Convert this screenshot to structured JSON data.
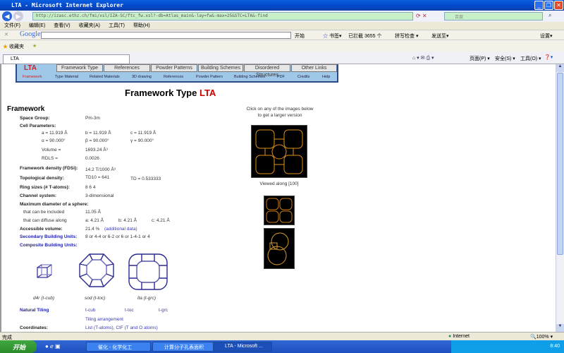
{
  "window": {
    "title": "LTA - Microsoft Internet Explorer"
  },
  "address": {
    "url": "http://izasc.ethz.ch/fmi/xsl/IZA-SC/ftc_fw.xsl?-db=Atlas_main&-lay=fw&-max=25&STC=LTA&-find",
    "search_placeholder": "百度"
  },
  "menu": [
    "文件(F)",
    "编辑(E)",
    "查看(V)",
    "收藏夹(A)",
    "工具(T)",
    "帮助(H)"
  ],
  "google_bar": {
    "logo": "Google",
    "start": "开始",
    "bookmarks": "书签▾",
    "blocked": "已拦截 3655 个",
    "spellcheck": "拼写检查 ▾",
    "send": "发送至▾",
    "settings": "设置▾"
  },
  "favorites": {
    "label": "收藏夹"
  },
  "tab": {
    "label": "LTA"
  },
  "ie_cmds": [
    "页面(P) ▾",
    "安全(S) ▾",
    "工具(O) ▾"
  ],
  "nav": {
    "code": "LTA",
    "tabs": [
      "Framework Type",
      "References",
      "Powder Patterns",
      "Building Schemes",
      "Disordered Structures",
      "Other Links"
    ],
    "sub": [
      "Framework",
      "Type Material",
      "Related Materials",
      "3D drawing",
      "References",
      "Powder Pattern",
      "Building Schemes",
      "PDF",
      "Credits",
      "Help"
    ]
  },
  "page": {
    "title_prefix": "Framework Type ",
    "title_code": "LTA",
    "section": "Framework",
    "space_group_label": "Space Group:",
    "space_group": "Pm-3m",
    "cell_label": "Cell Parameters:",
    "a": "a = 11.919 Å",
    "b": "b = 11.919 Å",
    "c": "c = 11.919 Å",
    "alpha": "α = 90.000°",
    "beta": "β = 90.000°",
    "gamma": "γ = 90.000°",
    "volume_label": "Volume =",
    "volume": "1693.24 Å³",
    "rdls_label": "RDLS =",
    "rdls": "0.0026",
    "fd_label": "Framework density (FDSi):",
    "fd": "14.2 T/1000 Å³",
    "td_label": "Topological density:",
    "td10": "TD10 = 641",
    "td": "TD = 0.533333",
    "rings_label": "Ring sizes (# T-atoms):",
    "rings": "8  6  4",
    "channel_label": "Channel system:",
    "channel": "3-dimensional",
    "maxdiam_label": "Maximum diameter of a sphere:",
    "included_label": "that can be included",
    "included": "11.05 Å",
    "diffuse_label": "that can diffuse along",
    "diff_a": "a:  4.21 Å",
    "diff_b": "b:  4.21 Å",
    "diff_c": "c:  4.21 Å",
    "accvol_label": "Accessible volume:",
    "accvol": "21.4  %",
    "accvol_link": "(additional data)",
    "sbu_label": "Secondary Building Units:",
    "sbu": "8 or 4-4 or 6-2 or 6 or 1-4-1 or 4",
    "cbu_label": "Composite Building Units:",
    "cbus": [
      "d4r (t-cub)",
      "sod (t-toc)",
      "lta (t-grc)"
    ],
    "tiling_label": "Natural Tiling",
    "tilings": [
      "t-cub",
      "t-toc",
      "t-grc"
    ],
    "tiling_arr": "Tiling arrangement",
    "coord_label": "Coordinates:",
    "coord": "List (T-atoms), CIF (T and O atoms)",
    "images_hint_1": "Click on any of the images below",
    "images_hint_2": "to get a larger version",
    "viewed": "Viewed along [100]"
  },
  "status": {
    "left": "完成",
    "zone": "Internet",
    "zoom": "100%"
  },
  "taskbar": {
    "start": "开始",
    "tasks": [
      "催化 - 化学化工",
      "计算分子孔表面积",
      "LTA - Microsoft ..."
    ],
    "clock": "8:40"
  },
  "colors": {
    "accent": "#cc0000",
    "nav": "#9fc8e8",
    "link": "#2222aa"
  }
}
